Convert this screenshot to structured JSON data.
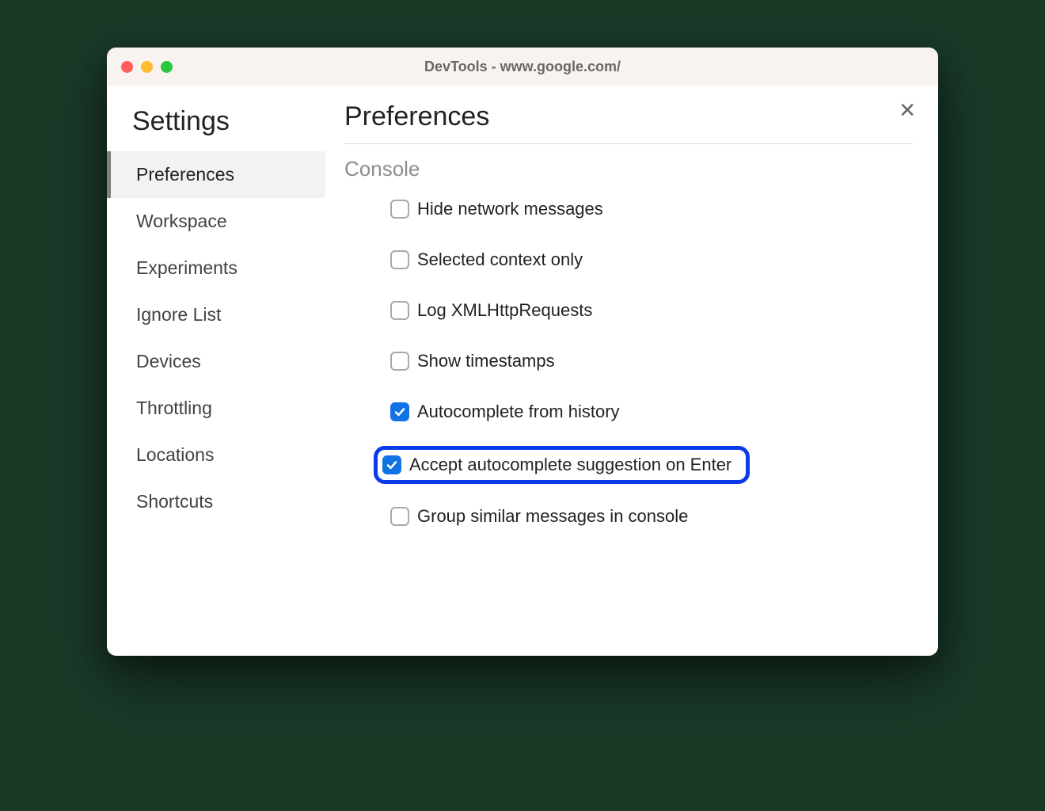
{
  "window": {
    "title": "DevTools - www.google.com/"
  },
  "sidebar": {
    "title": "Settings",
    "items": [
      {
        "label": "Preferences",
        "active": true
      },
      {
        "label": "Workspace",
        "active": false
      },
      {
        "label": "Experiments",
        "active": false
      },
      {
        "label": "Ignore List",
        "active": false
      },
      {
        "label": "Devices",
        "active": false
      },
      {
        "label": "Throttling",
        "active": false
      },
      {
        "label": "Locations",
        "active": false
      },
      {
        "label": "Shortcuts",
        "active": false
      }
    ]
  },
  "main": {
    "title": "Preferences",
    "section": "Console",
    "options": [
      {
        "label": "Hide network messages",
        "checked": false,
        "highlighted": false
      },
      {
        "label": "Selected context only",
        "checked": false,
        "highlighted": false
      },
      {
        "label": "Log XMLHttpRequests",
        "checked": false,
        "highlighted": false
      },
      {
        "label": "Show timestamps",
        "checked": false,
        "highlighted": false
      },
      {
        "label": "Autocomplete from history",
        "checked": true,
        "highlighted": false
      },
      {
        "label": "Accept autocomplete suggestion on Enter",
        "checked": true,
        "highlighted": true
      },
      {
        "label": "Group similar messages in console",
        "checked": false,
        "highlighted": false
      }
    ]
  }
}
